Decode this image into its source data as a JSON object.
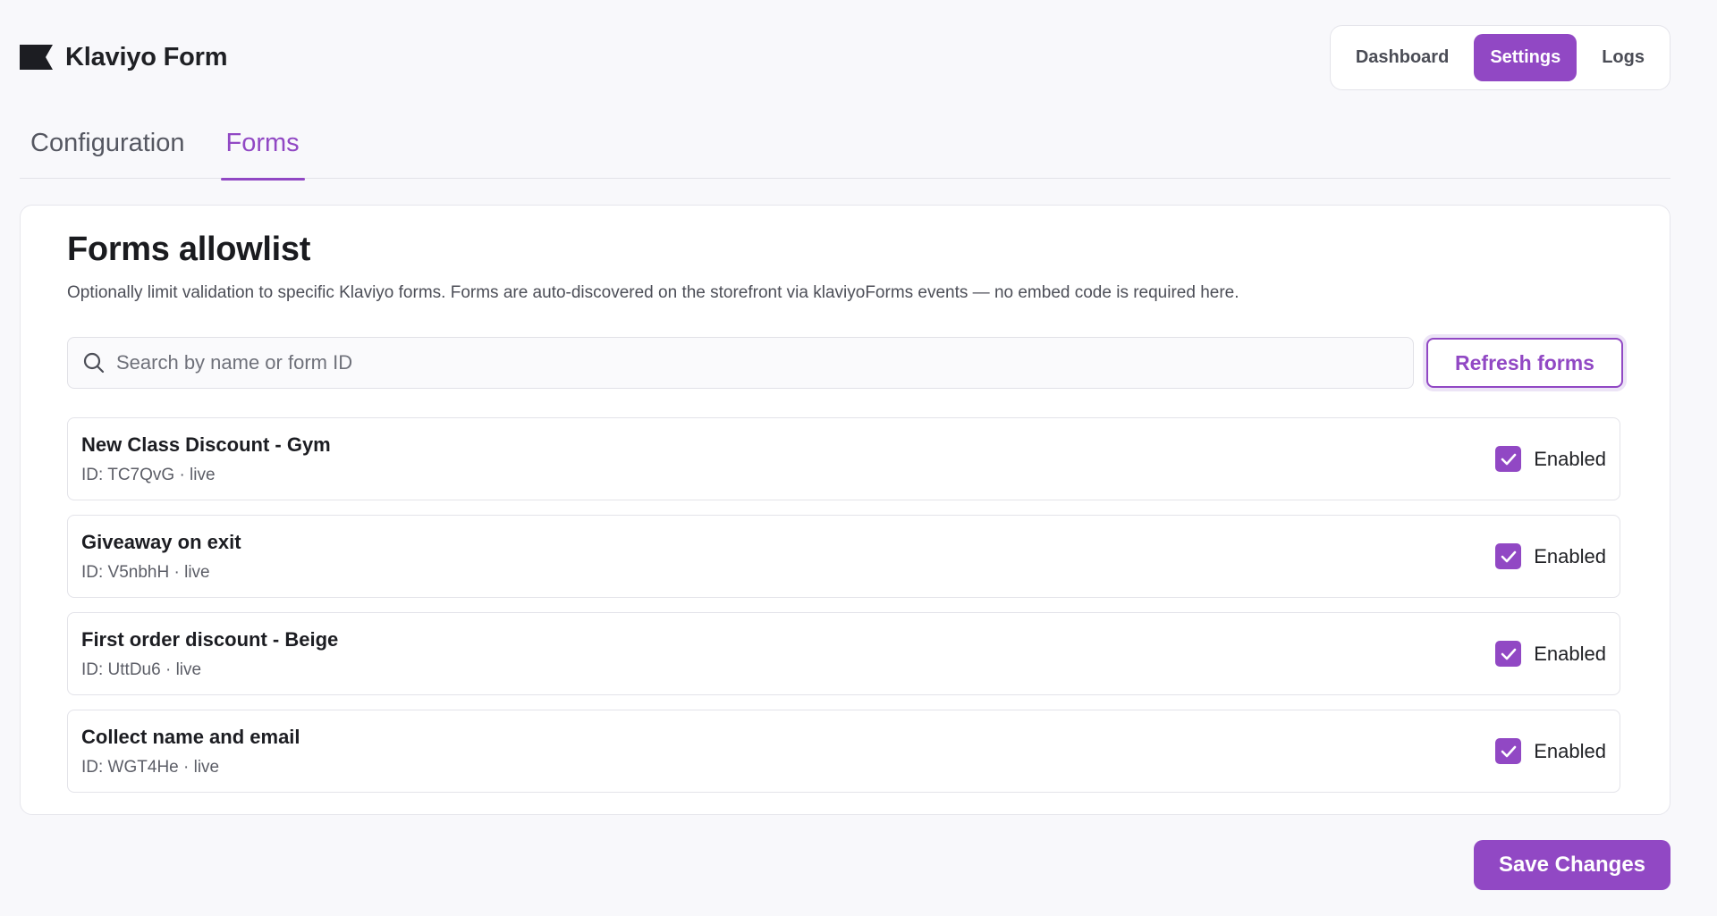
{
  "app": {
    "title": "Klaviyo Form",
    "logo_icon": "flag-logo-icon"
  },
  "topnav": {
    "items": [
      {
        "label": "Dashboard",
        "active": false
      },
      {
        "label": "Settings",
        "active": true
      },
      {
        "label": "Logs",
        "active": false
      }
    ]
  },
  "tabs": [
    {
      "label": "Configuration",
      "active": false
    },
    {
      "label": "Forms",
      "active": true
    }
  ],
  "card": {
    "title": "Forms allowlist",
    "description": "Optionally limit validation to specific Klaviyo forms. Forms are auto-discovered on the storefront via klaviyoForms events — no embed code is required here.",
    "search_placeholder": "Search by name or form ID",
    "search_value": "",
    "refresh_label": "Refresh forms"
  },
  "forms": [
    {
      "name": "New Class Discount - Gym",
      "meta": "ID: TC7QvG · live",
      "enabled": true,
      "enabled_label": "Enabled"
    },
    {
      "name": "Giveaway on exit",
      "meta": "ID: V5nbhH · live",
      "enabled": true,
      "enabled_label": "Enabled"
    },
    {
      "name": "First order discount - Beige",
      "meta": "ID: UttDu6 · live",
      "enabled": true,
      "enabled_label": "Enabled"
    },
    {
      "name": "Collect name and email",
      "meta": "ID: WGT4He · live",
      "enabled": true,
      "enabled_label": "Enabled"
    }
  ],
  "footer": {
    "save_label": "Save Changes"
  },
  "colors": {
    "accent": "#9148c4",
    "background": "#f8f8fb",
    "card": "#ffffff",
    "text": "#1f2024",
    "muted": "#5c5e67"
  }
}
